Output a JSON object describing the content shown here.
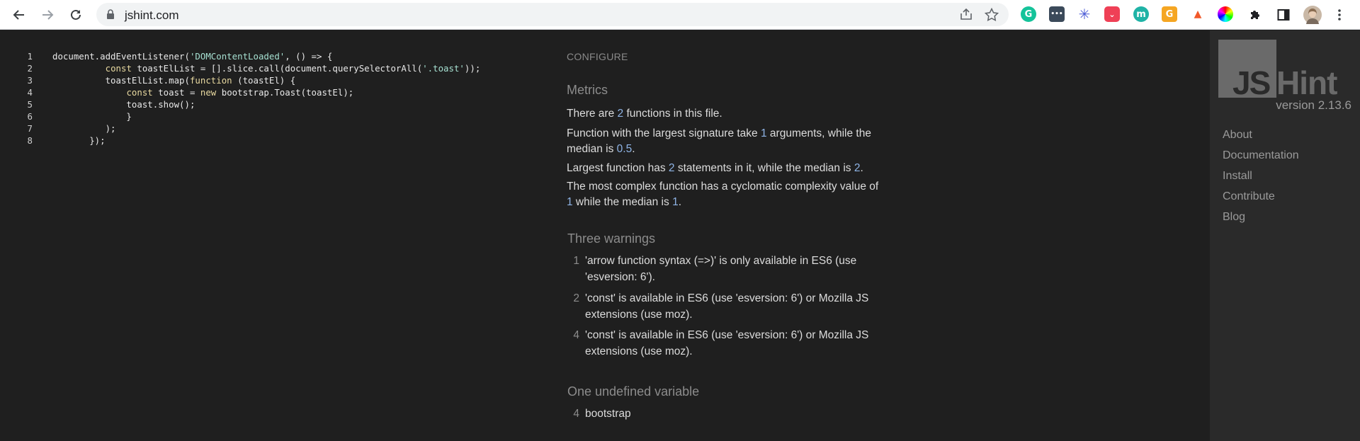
{
  "browser": {
    "url": "jshint.com",
    "extensions": [
      {
        "name": "grammarly",
        "color": "#15c39a",
        "glyph": "G"
      },
      {
        "name": "dots",
        "color": "#3b4a5a",
        "glyph": "•••"
      },
      {
        "name": "snowflake",
        "color": "#4b5bd6",
        "glyph": "✳"
      },
      {
        "name": "pocket",
        "color": "#ef4056",
        "glyph": "⌄"
      },
      {
        "name": "m",
        "color": "#1fb3a6",
        "glyph": "m"
      },
      {
        "name": "g-orange",
        "color": "#f5a623",
        "glyph": "G"
      },
      {
        "name": "lighthouse",
        "color": "#f1592a",
        "glyph": "▲"
      },
      {
        "name": "color-wheel",
        "color": "#d94bd3",
        "glyph": "●"
      }
    ]
  },
  "editor": {
    "lines": [
      {
        "n": "1",
        "code": [
          [
            "p",
            "document.addEventListener("
          ],
          [
            "s",
            "'DOMContentLoaded'"
          ],
          [
            "p",
            ", () => {"
          ]
        ]
      },
      {
        "n": "2",
        "code": [
          [
            "p",
            "          "
          ],
          [
            "k",
            "const"
          ],
          [
            "p",
            " toastElList = [].slice.call(document.querySelectorAll("
          ],
          [
            "s",
            "'.toast'"
          ],
          [
            "p",
            "));"
          ]
        ]
      },
      {
        "n": "3",
        "code": [
          [
            "p",
            "          toastElList.map("
          ],
          [
            "k",
            "function"
          ],
          [
            "p",
            " (toastEl) {"
          ]
        ]
      },
      {
        "n": "4",
        "code": [
          [
            "p",
            "              "
          ],
          [
            "k",
            "const"
          ],
          [
            "p",
            " toast = "
          ],
          [
            "k",
            "new"
          ],
          [
            "p",
            " bootstrap.Toast(toastEl);"
          ]
        ]
      },
      {
        "n": "5",
        "code": [
          [
            "p",
            "              toast.show();"
          ]
        ]
      },
      {
        "n": "6",
        "code": [
          [
            "p",
            "              }"
          ]
        ]
      },
      {
        "n": "7",
        "code": [
          [
            "p",
            "          );"
          ]
        ]
      },
      {
        "n": "8",
        "code": [
          [
            "p",
            "       });"
          ]
        ]
      }
    ]
  },
  "report": {
    "configure": "CONFIGURE",
    "metrics_heading": "Metrics",
    "metrics": {
      "m1_a": "There are ",
      "m1_n": "2",
      "m1_b": " functions in this file.",
      "m2_a": "Function with the largest signature take ",
      "m2_n1": "1",
      "m2_b": " arguments, while the median is ",
      "m2_n2": "0.5",
      "m2_c": ".",
      "m3_a": "Largest function has ",
      "m3_n1": "2",
      "m3_b": " statements in it, while the median is ",
      "m3_n2": "2",
      "m3_c": ".",
      "m4_a": "The most complex function has a cyclomatic complexity value of ",
      "m4_n1": "1",
      "m4_b": " while the median is ",
      "m4_n2": "1",
      "m4_c": "."
    },
    "warnings_heading": "Three warnings",
    "warnings": [
      {
        "line": "1",
        "text": "'arrow function syntax (=>)' is only available in ES6 (use 'esversion: 6')."
      },
      {
        "line": "2",
        "text": "'const' is available in ES6 (use 'esversion: 6') or Mozilla JS extensions (use moz)."
      },
      {
        "line": "4",
        "text": "'const' is available in ES6 (use 'esversion: 6') or Mozilla JS extensions (use moz)."
      }
    ],
    "undefined_heading": "One undefined variable",
    "undefined": [
      {
        "line": "4",
        "name": "bootstrap"
      }
    ]
  },
  "sidebar": {
    "logo_js": "JS",
    "logo_hint": "Hint",
    "version": "version 2.13.6",
    "nav": [
      "About",
      "Documentation",
      "Install",
      "Contribute",
      "Blog"
    ]
  }
}
